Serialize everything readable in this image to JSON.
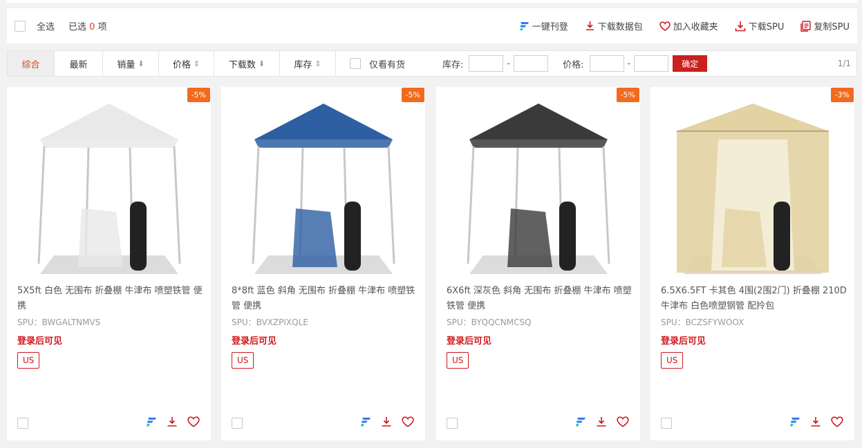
{
  "selection_bar": {
    "select_all": "全选",
    "selected_prefix": "已选",
    "selected_count": "0",
    "selected_suffix": "项",
    "actions": [
      {
        "label": "一键刊登",
        "icon": "publish-icon"
      },
      {
        "label": "下载数据包",
        "icon": "download-icon"
      },
      {
        "label": "加入收藏夹",
        "icon": "heart-icon"
      },
      {
        "label": "下载SPU",
        "icon": "download-icon"
      },
      {
        "label": "复制SPU",
        "icon": "copy-icon"
      }
    ]
  },
  "filter_bar": {
    "tabs": [
      {
        "label": "综合",
        "arrow": "",
        "active": true
      },
      {
        "label": "最新",
        "arrow": ""
      },
      {
        "label": "销量",
        "arrow": "⬇"
      },
      {
        "label": "价格",
        "arrow": "⇕"
      },
      {
        "label": "下载数",
        "arrow": "⬇"
      },
      {
        "label": "库存",
        "arrow": "⇕"
      }
    ],
    "in_stock_label": "仅看有货",
    "stock_label": "库存:",
    "price_label": "价格:",
    "dash": "-",
    "confirm_label": "确定",
    "pager": "1/1"
  },
  "products": [
    {
      "discount": "-5%",
      "title": "5X5ft 白色 无围布 折叠棚 牛津布 喷塑铁管 便携",
      "spu": "SPU：BWGALTNMVS",
      "login_text": "登录后可见",
      "region": "US",
      "canopy_color": "#e9e9e9"
    },
    {
      "discount": "-5%",
      "title": "8*8ft 蓝色 斜角 无围布 折叠棚 牛津布 喷塑铁管 便携",
      "spu": "SPU：BVXZPIXQLE",
      "login_text": "登录后可见",
      "region": "US",
      "canopy_color": "#2e5fa3"
    },
    {
      "discount": "-5%",
      "title": "6X6ft 深灰色 斜角 无围布 折叠棚 牛津布 喷塑铁管 便携",
      "spu": "SPU：BYQQCNMCSQ",
      "login_text": "登录后可见",
      "region": "US",
      "canopy_color": "#3a3a3a"
    },
    {
      "discount": "-3%",
      "title": "6.5X6.5FT 卡其色 4围(2围2门) 折叠棚 210D牛津布 白色喷塑钢管 配拎包",
      "spu": "SPU：BCZSFYWOOX",
      "login_text": "登录后可见",
      "region": "US",
      "canopy_color": "#e3d2a2"
    }
  ]
}
